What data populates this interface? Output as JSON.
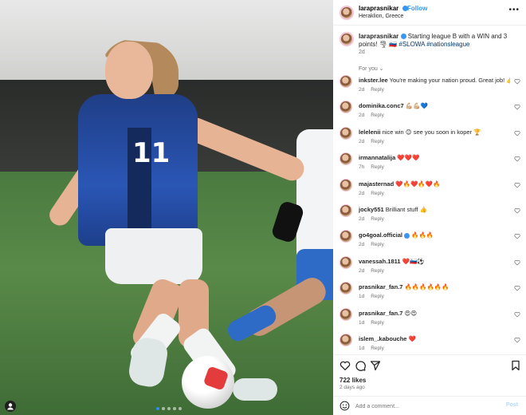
{
  "post": {
    "username": "laraprasnikar",
    "follow_label": "Follow",
    "location": "Heraklion, Greece",
    "more_label": "•••"
  },
  "caption": {
    "username": "laraprasnikar",
    "text": "Starting league B with a WIN and 3 points! 🌪",
    "hashtags": "🇸🇮 #SLOWA #nationsleague",
    "time": "2d"
  },
  "sort_label": "For you ⌄",
  "reply_label": "Reply",
  "comments": [
    {
      "user": "inkster.lee",
      "text": "You're making your nation proud. Great job! 👍",
      "time": "2d"
    },
    {
      "user": "dominika.conc7",
      "text": "💪🏼💪🏼💙",
      "time": "2d"
    },
    {
      "user": "lelelenii",
      "text": "nice win 😊 see you soon in koper 🏆",
      "time": "2d"
    },
    {
      "user": "irmannatalija",
      "text": "❤️❤️❤️",
      "time": "7h"
    },
    {
      "user": "majasternad",
      "text": "❤️🔥❤️🔥❤️🔥",
      "time": "2d"
    },
    {
      "user": "jocky551",
      "text": "Brilliant stuff 👍",
      "time": "2d"
    },
    {
      "user": "go4goal.official",
      "text": "🔥🔥🔥",
      "time": "2d"
    },
    {
      "user": "vanessah.1811",
      "text": "❤️🇸🇮⚽",
      "time": "2d"
    },
    {
      "user": "prasnikar_fan.7",
      "text": "🔥🔥🔥🔥🔥🔥",
      "time": "1d"
    },
    {
      "user": "prasnikar_fan.7",
      "text": "😍😍",
      "time": "1d"
    },
    {
      "user": "islem_.kabouche",
      "text": "❤️",
      "time": "1d"
    }
  ],
  "likes": "722 likes",
  "posted_ago": "2 days ago",
  "add_comment": {
    "placeholder": "Add a comment...",
    "post_label": "Post"
  },
  "photo": {
    "shirt_number": "11"
  },
  "colors": {
    "verified": "#3897f0",
    "link": "#00376b",
    "muted": "#737373",
    "post_disabled": "#b8d8fb",
    "carousel_active": "#2f8bf0"
  },
  "icons": [
    "heart-icon",
    "comment-icon",
    "share-icon",
    "bookmark-icon",
    "emoji-icon",
    "more-icon",
    "user-tag-icon"
  ]
}
